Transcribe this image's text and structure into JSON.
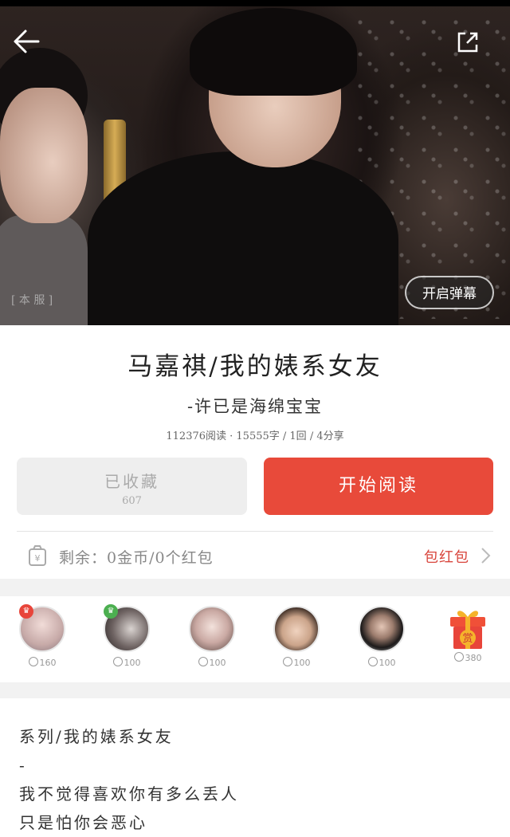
{
  "header": {
    "back_icon": "arrow-left-icon",
    "share_icon": "share-external-icon",
    "watermark": "[ 本 服 ]",
    "danmaku_label": "开启弹幕"
  },
  "book": {
    "title": "马嘉祺/我的婊系女友",
    "author": "-许已是海绵宝宝",
    "stats": "112376阅读 · 15555字 / 1回 / 4分享"
  },
  "actions": {
    "collect_label": "已收藏",
    "collect_count": "607",
    "read_label": "开始阅读"
  },
  "redpacket": {
    "icon": "money-bag-icon",
    "remain_text": "剩余：0金币/0个红包",
    "link_label": "包红包",
    "accent": "#d8453c"
  },
  "fans": [
    {
      "coins": "160",
      "badge": "crown",
      "badge_color": "#e8453a"
    },
    {
      "coins": "100",
      "badge": "crown",
      "badge_color": "#4caf50"
    },
    {
      "coins": "100"
    },
    {
      "coins": "100"
    },
    {
      "coins": "100"
    },
    {
      "coins": "380",
      "gift_label": "赏"
    }
  ],
  "content": {
    "lines": [
      "系列/我的婊系女友",
      "-",
      "我不觉得喜欢你有多么丢人",
      "只是怕你会恶心"
    ]
  },
  "colors": {
    "primary": "#e84a3a",
    "muted_button": "#eeeeee"
  }
}
